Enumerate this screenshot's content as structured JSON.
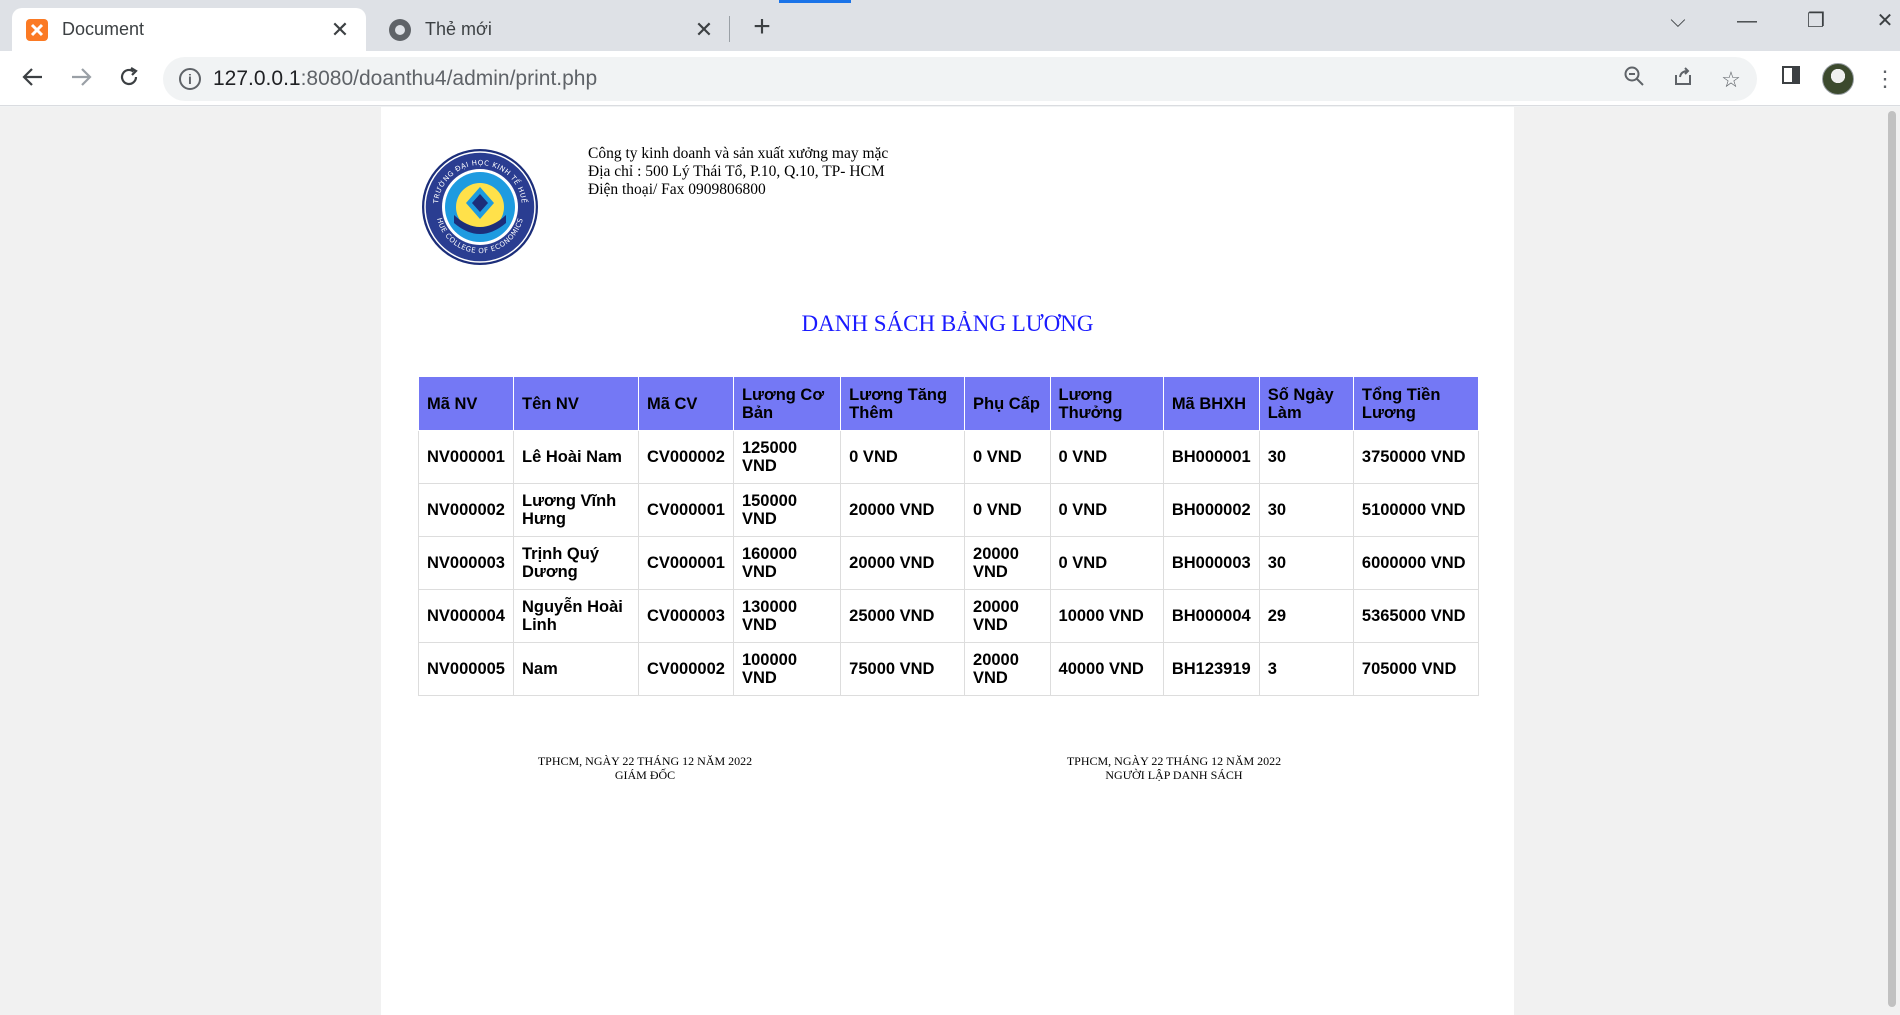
{
  "browser": {
    "tabs": [
      {
        "title": "Document",
        "active": true,
        "icon": "xampp-icon"
      },
      {
        "title": "Thẻ mới",
        "active": false,
        "icon": "chrome-icon"
      }
    ],
    "url_host": "127.0.0.1",
    "url_path": ":8080/doanthu4/admin/print.php"
  },
  "page": {
    "company": {
      "name": "Công ty kinh doanh và sản xuất xưởng may mặc",
      "address": "Địa chỉ : 500 Lý Thái Tổ, P.10, Q.10, TP- HCM",
      "phone": "Điện thoại/ Fax 0909806800"
    },
    "logo": {
      "ring_text_top": "TRƯỜNG ĐẠI HỌC KINH TẾ HUẾ",
      "ring_text_bottom": "HUE COLLEGE OF ECONOMICS"
    },
    "title": "DANH SÁCH BẢNG LƯƠNG",
    "table": {
      "headers": [
        "Mã NV",
        "Tên NV",
        "Mã CV",
        "Lương Cơ Bản",
        "Lương Tăng Thêm",
        "Phụ Cấp",
        "Lương Thưởng",
        "Mã BHXH",
        "Số Ngày Làm",
        "Tổng Tiền Lương"
      ],
      "rows": [
        [
          "NV000001",
          "Lê Hoài Nam",
          "CV000002",
          "125000 VND",
          "0 VND",
          "0 VND",
          "0 VND",
          "BH000001",
          "30",
          "3750000 VND"
        ],
        [
          "NV000002",
          "Lương Vĩnh Hưng",
          "CV000001",
          "150000 VND",
          "20000 VND",
          "0 VND",
          "0 VND",
          "BH000002",
          "30",
          "5100000 VND"
        ],
        [
          "NV000003",
          "Trịnh Quý Dương",
          "CV000001",
          "160000 VND",
          "20000 VND",
          "20000 VND",
          "0 VND",
          "BH000003",
          "30",
          "6000000 VND"
        ],
        [
          "NV000004",
          "Nguyễn Hoài Linh",
          "CV000003",
          "130000 VND",
          "25000 VND",
          "20000 VND",
          "10000 VND",
          "BH000004",
          "29",
          "5365000 VND"
        ],
        [
          "NV000005",
          "Nam",
          "CV000002",
          "100000 VND",
          "75000 VND",
          "20000 VND",
          "40000 VND",
          "BH123919",
          "3",
          "705000 VND"
        ]
      ]
    },
    "signatures": {
      "left_date": "TPHCM, NGÀY 22 THÁNG 12 NĂM 2022",
      "left_role": "GIÁM ĐỐC",
      "right_date": "TPHCM, NGÀY 22 THÁNG 12 NĂM 2022",
      "right_role": "NGƯỜI LẬP DANH SÁCH"
    }
  },
  "colors": {
    "header_bg": "#7478f5",
    "title": "#1a1aff",
    "accent": "#1a73e8"
  }
}
